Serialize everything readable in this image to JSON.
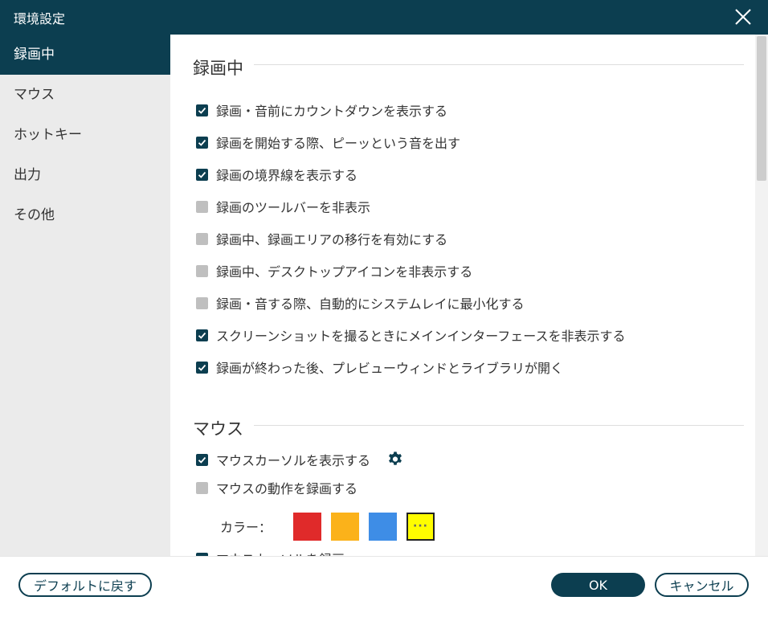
{
  "window": {
    "title": "環境設定"
  },
  "sidebar": {
    "items": [
      {
        "label": "録画中"
      },
      {
        "label": "マウス"
      },
      {
        "label": "ホットキー"
      },
      {
        "label": "出力"
      },
      {
        "label": "その他"
      }
    ]
  },
  "recording": {
    "heading": "録画中",
    "options": [
      {
        "label": "録画・音前にカウントダウンを表示する",
        "checked": true
      },
      {
        "label": "録画を開始する際、ピーッという音を出す",
        "checked": true
      },
      {
        "label": "録画の境界線を表示する",
        "checked": true
      },
      {
        "label": "録画のツールバーを非表示",
        "checked": false
      },
      {
        "label": "録画中、録画エリアの移行を有効にする",
        "checked": false
      },
      {
        "label": "録画中、デスクトップアイコンを非表示する",
        "checked": false
      },
      {
        "label": "録画・音する際、自動的にシステムレイに最小化する",
        "checked": false
      },
      {
        "label": "スクリーンショットを撮るときにメインインターフェースを非表示する",
        "checked": true
      },
      {
        "label": "録画が終わった後、プレビューウィンドとライブラリが開く",
        "checked": true
      }
    ]
  },
  "mouse": {
    "heading": "マウス",
    "options": [
      {
        "label": "マウスカーソルを表示する",
        "checked": true
      },
      {
        "label": "マウスの動作を録画する",
        "checked": false
      }
    ],
    "color_label": "カラー：",
    "colors": [
      "#e02a2a",
      "#fbb21a",
      "#3e8de6",
      "#fffd00"
    ],
    "selected_color_mark": "···",
    "partial_option": {
      "label": "マウスカーソルを録画",
      "checked": true
    }
  },
  "footer": {
    "default_label": "デフォルトに戻す",
    "ok_label": "OK",
    "cancel_label": "キャンセル"
  },
  "theme": {
    "accent": "#0c3e50",
    "unchecked": "#bfbfbf"
  }
}
